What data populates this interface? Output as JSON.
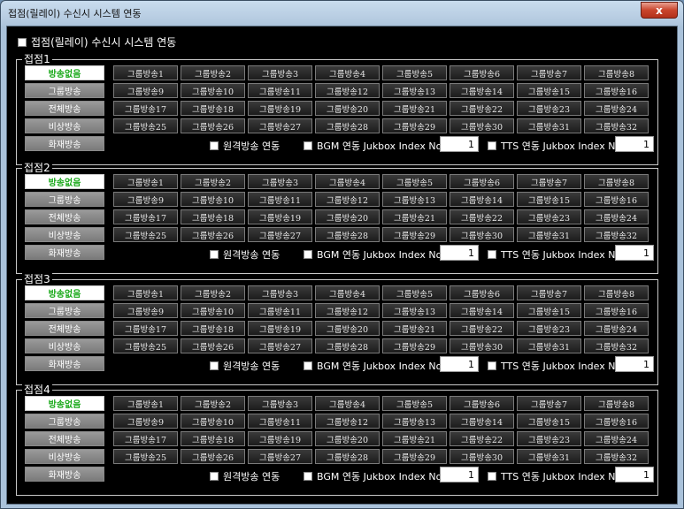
{
  "window": {
    "title": "접점(릴레이) 수신시 시스템 연동",
    "close_glyph": "x"
  },
  "master_checkbox": {
    "label": "접점(릴레이) 수신시 시스템 연동"
  },
  "mode_labels": [
    "방송없음",
    "그룹방송",
    "전체방송",
    "비상방송",
    "화재방송"
  ],
  "group_button_prefix": "그룹방송",
  "option_labels": {
    "remote": "원격방송 연동",
    "bgm": "BGM 연동 Jukbox Index No.",
    "tts": "TTS 연동 Jukbox Index No."
  },
  "colors": {
    "active_mode_text": "#18a818",
    "close_button": "#c9452c"
  },
  "groups": [
    {
      "label": "접점1",
      "active_mode": 0,
      "bgm_index": "1",
      "tts_index": "1"
    },
    {
      "label": "접점2",
      "active_mode": 0,
      "bgm_index": "1",
      "tts_index": "1"
    },
    {
      "label": "접점3",
      "active_mode": 0,
      "bgm_index": "1",
      "tts_index": "1"
    },
    {
      "label": "접점4",
      "active_mode": 0,
      "bgm_index": "1",
      "tts_index": "1"
    }
  ]
}
